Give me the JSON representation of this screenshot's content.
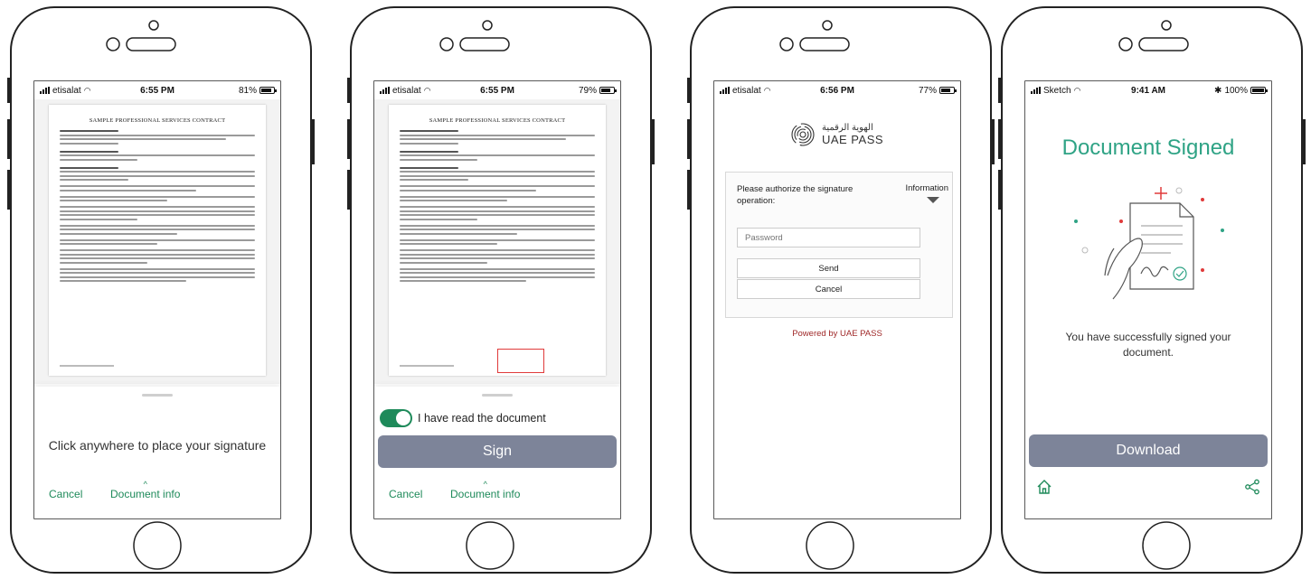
{
  "screens": [
    {
      "status": {
        "carrier": "etisalat",
        "time": "6:55 PM",
        "battery": "81%",
        "battery_level": 0.81
      },
      "document": {
        "title": "SAMPLE PROFESSIONAL SERVICES CONTRACT"
      },
      "hint": "Click anywhere to place your signature",
      "actions": {
        "cancel": "Cancel",
        "info": "Document info",
        "info_icon": "chevron-up-icon"
      }
    },
    {
      "status": {
        "carrier": "etisalat",
        "time": "6:55 PM",
        "battery": "79%",
        "battery_level": 0.79
      },
      "document": {
        "title": "SAMPLE PROFESSIONAL SERVICES CONTRACT"
      },
      "toggle": {
        "label": "I have read the document",
        "on": true
      },
      "sign_button": "Sign",
      "actions": {
        "cancel": "Cancel",
        "info": "Document info",
        "info_icon": "chevron-up-icon"
      }
    },
    {
      "status": {
        "carrier": "etisalat",
        "time": "6:56 PM",
        "battery": "77%",
        "battery_level": 0.77
      },
      "brand": {
        "arabic": "الهوية الرقمية",
        "english": "UAE PASS",
        "icon": "fingerprint-icon"
      },
      "auth": {
        "message": "Please authorize the signature operation:",
        "info": "Information",
        "password_placeholder": "Password",
        "send": "Send",
        "cancel": "Cancel"
      },
      "powered": "Powered by UAE PASS"
    },
    {
      "status": {
        "carrier": "Sketch",
        "time": "9:41 AM",
        "battery": "100%",
        "battery_level": 1.0,
        "bluetooth": "bluetooth-icon"
      },
      "title": "Document Signed",
      "message": "You have successfully signed your document.",
      "download": "Download",
      "icons": {
        "home": "home-icon",
        "share": "share-icon"
      }
    }
  ],
  "colors": {
    "accent_green": "#1e8a5a",
    "title_green": "#2fa385",
    "button_gray": "#7d8499",
    "uae_red": "#a02a2a",
    "signature_box": "#e03a3a"
  }
}
